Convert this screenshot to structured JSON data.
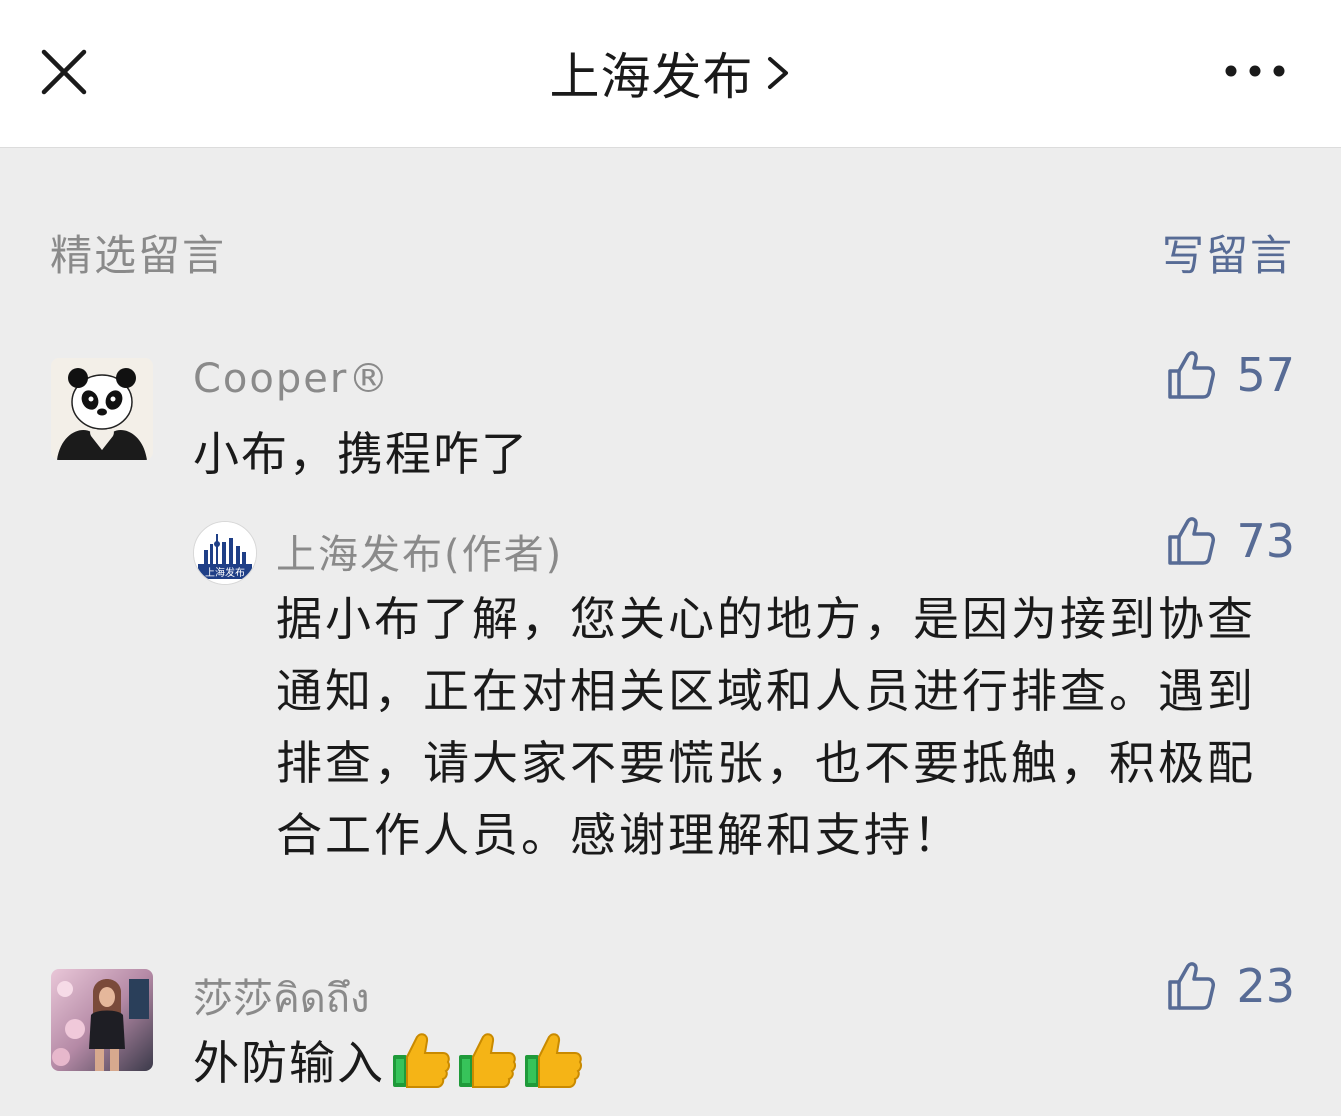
{
  "header": {
    "title": "上海发布",
    "close_icon": "close-icon",
    "chevron_icon": "chevron-right-icon",
    "more_icon": "more-icon"
  },
  "comments_section": {
    "title": "精选留言",
    "write_label": "写留言"
  },
  "comments": [
    {
      "nickname": "Cooper®",
      "avatar": "panda-avatar",
      "text": "小布，携程咋了",
      "likes": "57",
      "reply": {
        "nickname": "上海发布(作者)",
        "avatar": "shanghai-fabu-logo",
        "avatar_text": "上海发布",
        "text": "据小布了解，您关心的地方，是因为接到协查通知，正在对相关区域和人员进行排查。遇到排查，请大家不要慌张，也不要抵触，积极配合工作人员。感谢理解和支持！",
        "likes": "73"
      }
    },
    {
      "nickname": "莎莎คิดถึง",
      "avatar": "user-photo-avatar",
      "text": "外防输入",
      "emoji": [
        "thumbs-up-emoji",
        "thumbs-up-emoji",
        "thumbs-up-emoji"
      ],
      "likes": "23"
    }
  ],
  "colors": {
    "link": "#576b95",
    "background": "#ededed",
    "secondary_text": "#8a8a8a"
  }
}
